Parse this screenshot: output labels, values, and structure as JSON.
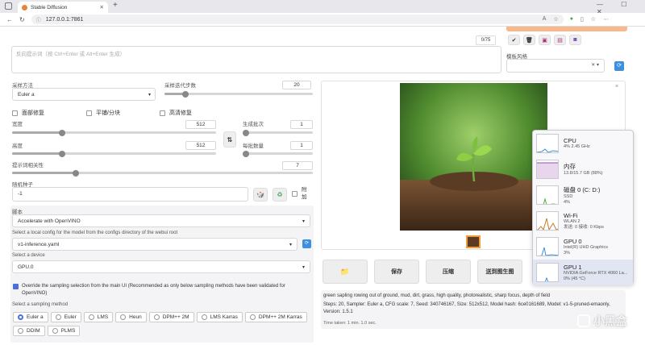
{
  "browser": {
    "tab_title": "Stable Diffusion",
    "url": "127.0.0.1:7861"
  },
  "prompt": {
    "counter": "0/75",
    "negative_placeholder": "反向提示词（按 Ctrl+Enter 或 Alt+Enter 生成）"
  },
  "styles": {
    "label": "模板风格"
  },
  "settings": {
    "sampler_label": "采样方法",
    "sampler_value": "Euler a",
    "steps_label": "采样迭代步数",
    "steps_value": "20",
    "check_restore_faces": "面部修复",
    "check_tiling": "平铺/分块",
    "check_hires": "高清修复",
    "width_label": "宽度",
    "width_value": "512",
    "height_label": "高度",
    "height_value": "512",
    "batch_count_label": "生成批次",
    "batch_count_value": "1",
    "batch_size_label": "每批数量",
    "batch_size_value": "1",
    "cfg_label": "提示词相关性",
    "cfg_value": "7",
    "seed_label": "随机种子",
    "seed_value": "-1",
    "extra_label": "附加"
  },
  "script": {
    "label": "脚本",
    "value": "Accelerate with OpenVINO",
    "config_hint": "Select a local config for the model from the configs directory of the webui root",
    "config_value": "v1-inference.yaml",
    "device_hint": "Select a device",
    "device_value": "GPU.0",
    "override_text": "Override the sampling selection from the main UI (Recommended as only below sampling methods have been validated for OpenVINO)",
    "sampling_hint": "Select a sampling method",
    "methods": [
      "Euler a",
      "Euler",
      "LMS",
      "Heun",
      "DPM++ 2M",
      "LMS Karras",
      "DPM++ 2M Karras",
      "DDIM",
      "PLMS"
    ]
  },
  "output": {
    "buttons": [
      "保存",
      "压缩",
      "送到图生图"
    ],
    "info_prompt": "green sapling rowing out of ground, mud, dirt, grass, high quality, photorealistic, sharp focus, depth of field",
    "info_params": "Steps: 20, Sampler: Euler a, CFG scale: 7, Seed: 340746167, Size: 512x512, Model hash: 6ce0161689, Model: v1-5-pruned-emaonly, Version: 1.5.1",
    "time_taken": "Time taken: 1 min. 1.0 sec."
  },
  "taskmgr": {
    "items": [
      {
        "title": "CPU",
        "sub1": "4%  2.45 GHz",
        "sub2": ""
      },
      {
        "title": "内存",
        "sub1": "13.8/15.7 GB (88%)",
        "sub2": ""
      },
      {
        "title": "磁盘 0 (C: D:)",
        "sub1": "SSD",
        "sub2": "4%"
      },
      {
        "title": "Wi-Fi",
        "sub1": "WLAN 2",
        "sub2": "发送: 0  接收: 0 Kbps"
      },
      {
        "title": "GPU 0",
        "sub1": "Intel(R) UHD Graphics",
        "sub2": "3%"
      },
      {
        "title": "GPU 1",
        "sub1": "NVIDIA GeForce RTX 4060 La...",
        "sub2": "0% (45 °C)"
      }
    ]
  },
  "watermark": "小黑盒",
  "colors": {
    "accent": "#4a6fdc",
    "generate": "#f7b98c"
  }
}
